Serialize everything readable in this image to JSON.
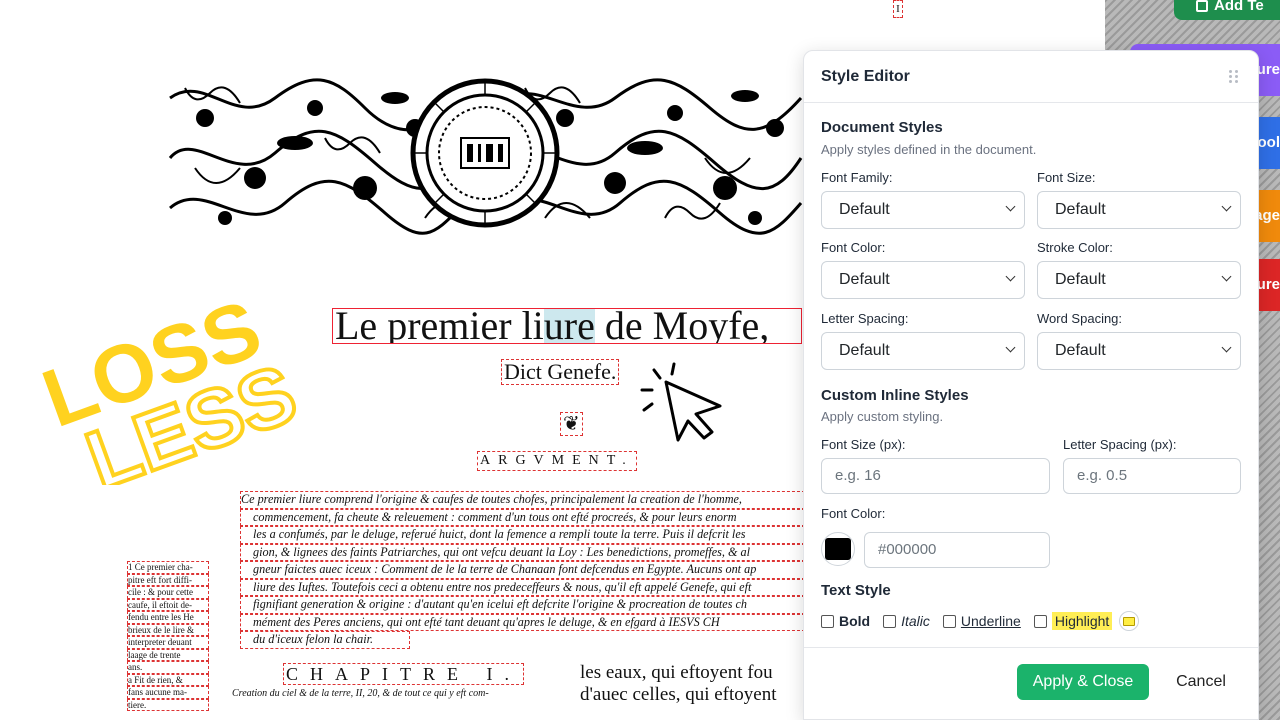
{
  "document": {
    "page_marker": "I",
    "title_parts": [
      "Le premier li",
      "ure",
      " de Moyfe,"
    ],
    "subtitle": "Dict Genefe.",
    "fleuron": "❦",
    "argument_heading": "ARGVMENT.",
    "argument_lines": [
      "Ce premier liure comprend l'origine & caufes de toutes chofes, principalement la creation de l'homme,",
      "commencement, fa cheute & releuement : comment d'un tous ont efté procreés, & pour leurs enorm",
      "les a confumés, par le deluge, referué huict, dont la femence a rempli toute la terre. Puis il defcrit les",
      "gion, & lignees des faints Patriarches, qui ont vefcu deuant la Loy : Les benedictions, promeffes, & al",
      "gneur faictes auec iceux : Comment de le la terre de Chanaan font defcendus en Egypte. Aucuns ont ap",
      "liure des Iuftes. Toutefois ceci a obtenu entre nos predeceffeurs & nous, qu'il eft appelé Genefe, qui eft",
      "fignifiant generation & origine : d'autant qu'en icelui eft defcrite l'origine & procreation de toutes ch",
      "mément des Peres anciens, qui ont efté tant deuant qu'apres le deluge, & en efgard à IESVS CH",
      "du d'iceux felon la chair."
    ],
    "margin_note_lines": [
      "1 Ce premier cha-",
      "pitre eft fort diffi-",
      "cile : & pour cette",
      "caufe, il eftoit de-",
      "fendu entre les He",
      "brieux de le lire &",
      "interpreter deuant",
      "laage de trente",
      "ans.",
      "a Fit de rien, &",
      "fans aucune ma-",
      "tiere."
    ],
    "chapter_heading": "CHAPITRE I.",
    "chapter_subtitle": "Creation du ciel & de la terre, II, 20, & de tout ce qui y eft com-",
    "column_two_lines": [
      "les eaux, qui eftoyent fou",
      "d'auec celles, qui eftoyent"
    ]
  },
  "promo": {
    "loss_word": "LOSS",
    "less_word": "LESS",
    "brand_yellow": "#ffd21f"
  },
  "background_buttons": {
    "top_green": "Add Te",
    "items": [
      {
        "label": "ture",
        "color": "#8b5cf6"
      },
      {
        "label": "ool",
        "color": "#2f6fe6"
      },
      {
        "label": "age",
        "color": "#f08a0c"
      },
      {
        "label": "ture",
        "color": "#dc2626"
      }
    ]
  },
  "style_editor": {
    "title": "Style Editor",
    "document_styles": {
      "title": "Document Styles",
      "description": "Apply styles defined in the document.",
      "font_family_label": "Font Family:",
      "font_family_value": "Default",
      "font_size_label": "Font Size:",
      "font_size_value": "Default",
      "font_color_label": "Font Color:",
      "font_color_value": "Default",
      "stroke_color_label": "Stroke Color:",
      "stroke_color_value": "Default",
      "letter_spacing_label": "Letter Spacing:",
      "letter_spacing_value": "Default",
      "word_spacing_label": "Word Spacing:",
      "word_spacing_value": "Default"
    },
    "custom_styles": {
      "title": "Custom Inline Styles",
      "description": "Apply custom styling.",
      "font_size_label": "Font Size (px):",
      "font_size_placeholder": "e.g. 16",
      "letter_spacing_label": "Letter Spacing (px):",
      "letter_spacing_placeholder": "e.g. 0.5",
      "font_color_label": "Font Color:",
      "font_color_value": "#000000",
      "text_style_label": "Text Style",
      "bold_label": "Bold",
      "italic_label": "Italic",
      "underline_label": "Underline",
      "highlight_label": "Highlight",
      "highlight_color": "#ffee55"
    },
    "apply_label": "Apply & Close",
    "cancel_label": "Cancel",
    "accent_color": "#1bb36b"
  }
}
